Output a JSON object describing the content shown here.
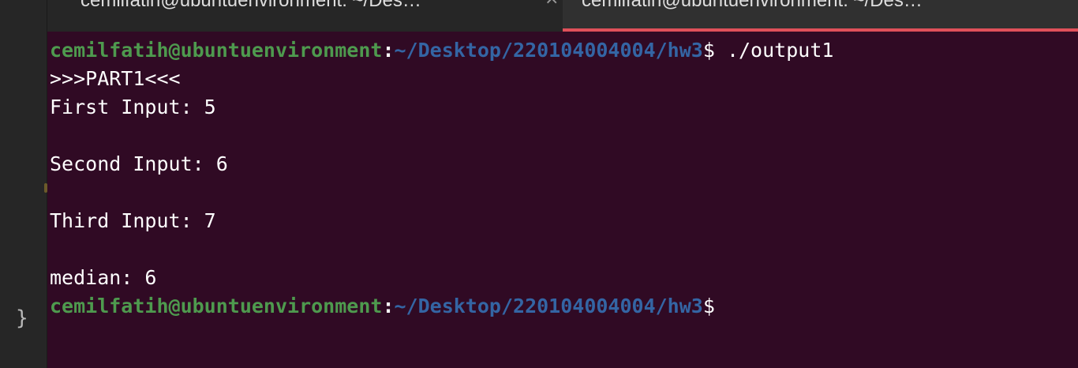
{
  "tabs": [
    {
      "label": "cemilfatih@ubuntuenvironment: ~/Des…",
      "close_glyph": "×",
      "active": false
    },
    {
      "label": "cemilfatih@ubuntuenvironment: ~/Des…",
      "active": true
    }
  ],
  "editor": {
    "brace": "}"
  },
  "terminal": {
    "prompt": {
      "user_host": "cemilfatih@ubuntuenvironment",
      "colon": ":",
      "path": "~/Desktop/220104004004/hw3",
      "dollar": "$"
    },
    "command": " ./output1",
    "output": {
      "part": ">>>PART1<<<",
      "first": "First Input: 5",
      "second": "Second Input: 6",
      "third": "Third Input: 7",
      "median": "median: 6"
    }
  }
}
